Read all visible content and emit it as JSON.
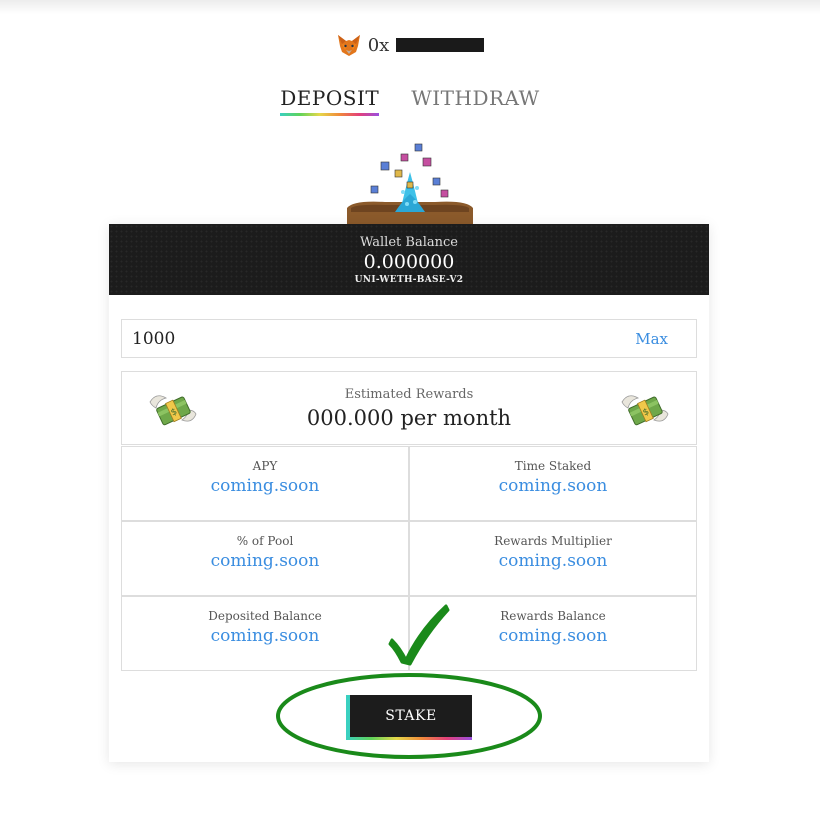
{
  "wallet": {
    "address_prefix": "0x",
    "icon": "metamask-fox-icon"
  },
  "tabs": [
    {
      "label": "DEPOSIT",
      "active": true
    },
    {
      "label": "WITHDRAW",
      "active": false
    }
  ],
  "balance": {
    "label": "Wallet Balance",
    "value": "0.000000",
    "token": "UNI-WETH-BASE-V2"
  },
  "amount": {
    "value": "1000",
    "max_label": "Max"
  },
  "rewards": {
    "label": "Estimated Rewards",
    "value": "000.000 per month",
    "icon": "money-with-wings-icon"
  },
  "stats": [
    {
      "label": "APY",
      "value": "coming.soon"
    },
    {
      "label": "Time Staked",
      "value": "coming.soon"
    },
    {
      "label": "% of Pool",
      "value": "coming.soon"
    },
    {
      "label": "Rewards Multiplier",
      "value": "coming.soon"
    },
    {
      "label": "Deposited Balance",
      "value": "coming.soon"
    },
    {
      "label": "Rewards Balance",
      "value": "coming.soon"
    }
  ],
  "stake_button": {
    "label": "STAKE"
  },
  "colors": {
    "link": "#3a8de0",
    "header_bg": "#1c1c1c",
    "annotation": "#1a8a1a"
  }
}
